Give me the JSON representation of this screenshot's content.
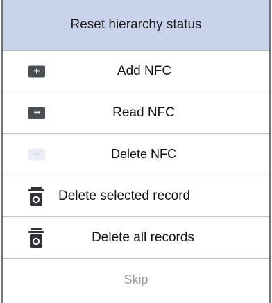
{
  "menu": {
    "header": "Reset hierarchy status",
    "items": [
      {
        "label": "Add  NFC",
        "icon": "plus-icon",
        "glyph": "+"
      },
      {
        "label": "Read NFC",
        "icon": "more-icon",
        "glyph": "•••"
      },
      {
        "label": "Delete NFC",
        "icon": "minus-icon",
        "glyph": "−"
      },
      {
        "label": "Delete selected record",
        "icon": "trash-icon"
      },
      {
        "label": "Delete all records",
        "icon": "trash-icon"
      }
    ],
    "skip": "Skip"
  }
}
